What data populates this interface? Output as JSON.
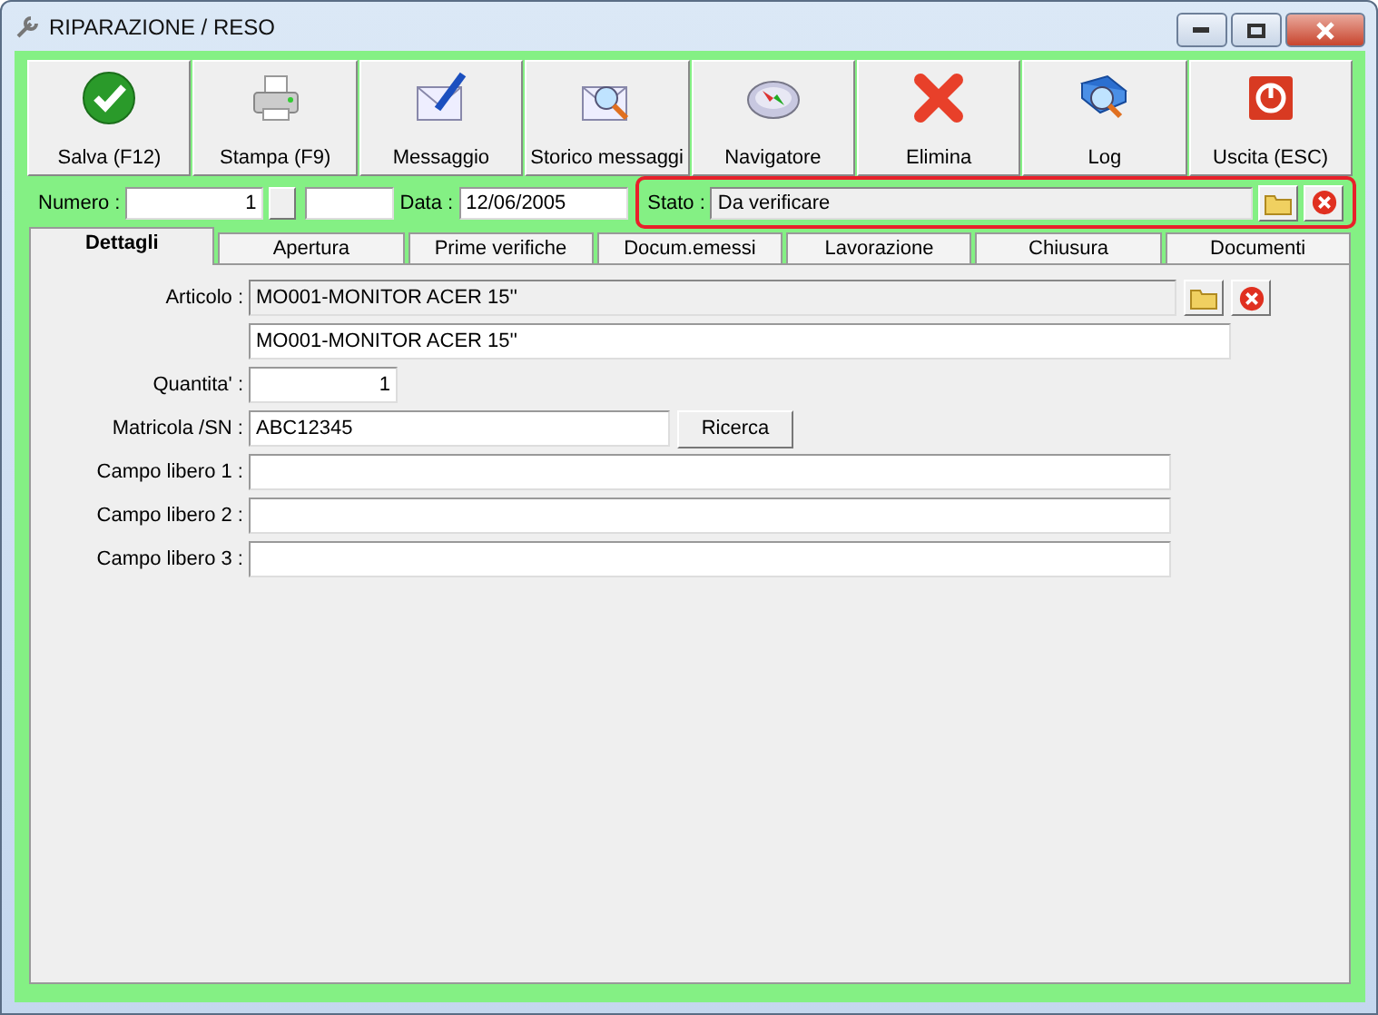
{
  "window": {
    "title": "RIPARAZIONE / RESO"
  },
  "toolbar": [
    {
      "label": "Salva (F12)"
    },
    {
      "label": "Stampa (F9)"
    },
    {
      "label": "Messaggio"
    },
    {
      "label": "Storico messaggi"
    },
    {
      "label": "Navigatore"
    },
    {
      "label": "Elimina"
    },
    {
      "label": "Log"
    },
    {
      "label": "Uscita (ESC)"
    }
  ],
  "header": {
    "numero_label": "Numero :",
    "numero_value": "1",
    "data_label": "Data :",
    "data_value": "12/06/2005",
    "stato_label": "Stato :",
    "stato_value": "Da verificare",
    "stato_highlighted": true
  },
  "tabs": [
    {
      "label": "Dettagli",
      "selected": true
    },
    {
      "label": "Apertura",
      "selected": false
    },
    {
      "label": "Prime verifiche",
      "selected": false
    },
    {
      "label": "Docum.emessi",
      "selected": false
    },
    {
      "label": "Lavorazione",
      "selected": false
    },
    {
      "label": "Chiusura",
      "selected": false
    },
    {
      "label": "Documenti",
      "selected": false
    }
  ],
  "fields": [
    {
      "label": "Articolo :",
      "value": "MO001-MONITOR ACER 15''",
      "kind": "lookup",
      "readonly": true
    },
    {
      "value": "MO001-MONITOR ACER 15''",
      "kind": "wide",
      "readonly": false
    },
    {
      "label": "Quantita' :",
      "value": "1",
      "kind": "number",
      "readonly": false
    },
    {
      "label": "Matricola /SN :",
      "value": "ABC12345",
      "kind": "search",
      "button": "Ricerca",
      "readonly": false
    },
    {
      "label": "Campo libero 1 :",
      "kind": "text",
      "readonly": false
    },
    {
      "label": "Campo libero 2 :",
      "kind": "text",
      "readonly": false
    },
    {
      "label": "Campo libero 3 :",
      "kind": "text",
      "readonly": false
    }
  ]
}
